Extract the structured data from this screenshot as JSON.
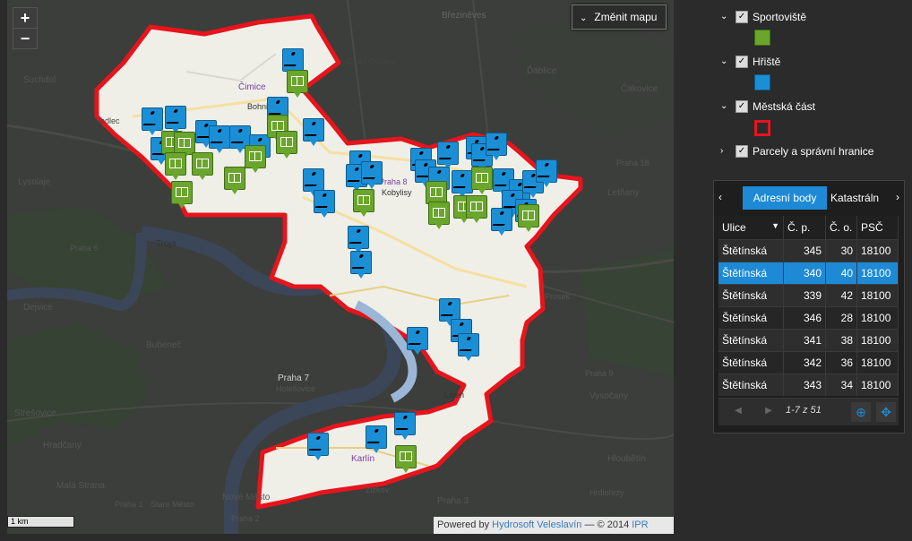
{
  "map": {
    "zoom_in_label": "+",
    "zoom_out_label": "−",
    "change_map_label": "Změnit mapu",
    "scale_label": "1 km",
    "attribution": {
      "prefix": "Powered by",
      "link1": "Hydrosoft Veleslavín",
      "middle": " — © 2014 ",
      "link2": "IPR Praha"
    },
    "places": [
      {
        "name": "Březiněves",
        "color": "#666"
      },
      {
        "name": "Suchdol",
        "color": "#555"
      },
      {
        "name": "Sedlec",
        "color": "#555"
      },
      {
        "name": "Lysolaje",
        "color": "#555"
      },
      {
        "name": "Čimice",
        "color": "#7a3fa0"
      },
      {
        "name": "Bohnice",
        "color": "#333"
      },
      {
        "name": "Dolní Chabry",
        "color": "#555"
      },
      {
        "name": "Ďáblice",
        "color": "#555"
      },
      {
        "name": "Čakovice",
        "color": "#555"
      },
      {
        "name": "Letňany",
        "color": "#555"
      },
      {
        "name": "Praha 18",
        "color": "#555"
      },
      {
        "name": "Kobylisy",
        "color": "#333"
      },
      {
        "name": "Praha 8",
        "color": "#7a3fa0"
      },
      {
        "name": "Troja",
        "color": "#333"
      },
      {
        "name": "Dejvice",
        "color": "#555"
      },
      {
        "name": "Bubeneč",
        "color": "#555"
      },
      {
        "name": "Praha 7",
        "color": "#cfcfcf"
      },
      {
        "name": "Holešovice",
        "color": "#555"
      },
      {
        "name": "Střešovice",
        "color": "#555"
      },
      {
        "name": "Hradčany",
        "color": "#555"
      },
      {
        "name": "Malá Strana",
        "color": "#555"
      },
      {
        "name": "Nové Město",
        "color": "#555"
      },
      {
        "name": "Staré Město",
        "color": "#555"
      },
      {
        "name": "Karlín",
        "color": "#7a3fa0"
      },
      {
        "name": "Libeň",
        "color": "#333"
      },
      {
        "name": "Prosek",
        "color": "#555"
      },
      {
        "name": "Vysočany",
        "color": "#555"
      },
      {
        "name": "Hloubětín",
        "color": "#555"
      },
      {
        "name": "Hrdlořezy",
        "color": "#555"
      },
      {
        "name": "Žižkov",
        "color": "#555"
      },
      {
        "name": "Praha 3",
        "color": "#555"
      },
      {
        "name": "Praha 9",
        "color": "#555"
      },
      {
        "name": "Praha 6",
        "color": "#555"
      },
      {
        "name": "Praha 2",
        "color": "#555"
      },
      {
        "name": "Praha 1",
        "color": "#555"
      }
    ]
  },
  "layers": [
    {
      "name": "Sportoviště",
      "checked": "✓",
      "arrow": "⌄"
    },
    {
      "name": "Hřiště",
      "checked": "✓",
      "arrow": "⌄"
    },
    {
      "name": "Městská část",
      "checked": "✓",
      "arrow": "⌄"
    },
    {
      "name": "Parcely a správní hranice",
      "checked": "✓",
      "arrow": "›"
    }
  ],
  "attributes": {
    "tab_left": "‹",
    "tab_right": "›",
    "tabs": [
      "Adresní body",
      "Katastráln"
    ],
    "columns": [
      "Ulice",
      "Č. p.",
      "Č. o.",
      "PSČ"
    ],
    "rows": [
      {
        "ulice": "Štětínská",
        "cp": "345",
        "co": "30",
        "psc": "18100"
      },
      {
        "ulice": "Štětínská",
        "cp": "340",
        "co": "40",
        "psc": "18100"
      },
      {
        "ulice": "Štětínská",
        "cp": "339",
        "co": "42",
        "psc": "18100"
      },
      {
        "ulice": "Štětínská",
        "cp": "346",
        "co": "28",
        "psc": "18100"
      },
      {
        "ulice": "Štětínská",
        "cp": "341",
        "co": "38",
        "psc": "18100"
      },
      {
        "ulice": "Štětínská",
        "cp": "342",
        "co": "36",
        "psc": "18100"
      },
      {
        "ulice": "Štětínská",
        "cp": "343",
        "co": "34",
        "psc": "18100"
      }
    ],
    "pager_info": "1-7 z 51",
    "pager_prev": "◀",
    "pager_next": "▶"
  }
}
